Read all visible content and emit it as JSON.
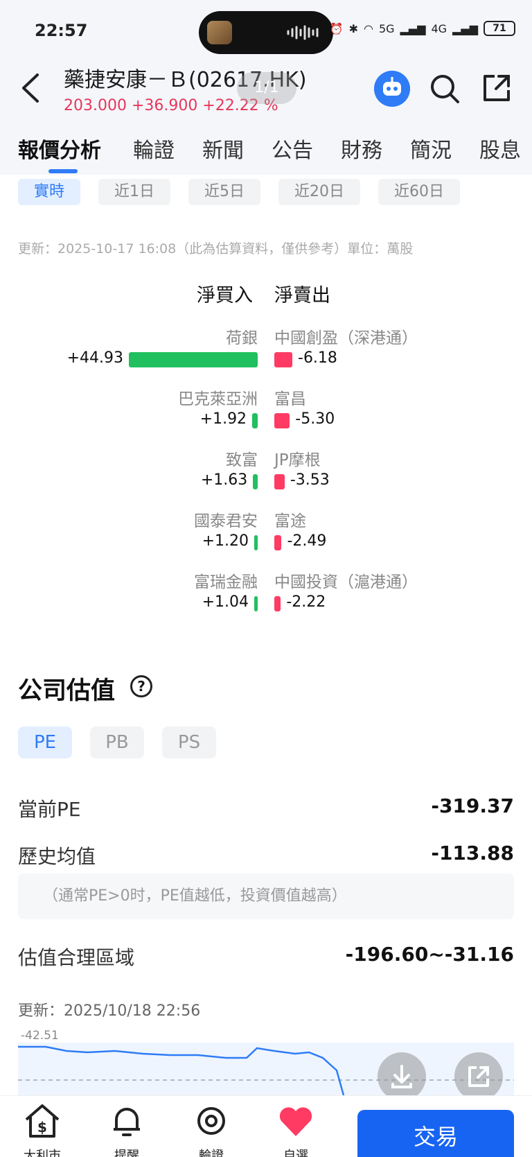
{
  "status_bar": {
    "time": "22:57",
    "net1": "5G",
    "net2": "4G",
    "battery": "71"
  },
  "header": {
    "stock_name": "藥捷安康－Ｂ(02617.HK)",
    "price_line": "203.000 +36.900 +22.22 %",
    "page_indicator": "1/1"
  },
  "tabs": [
    "報價分析",
    "輪證",
    "新聞",
    "公告",
    "財務",
    "簡況",
    "股息"
  ],
  "broker_flow": {
    "periods": [
      "實時",
      "近1日",
      "近5日",
      "近20日",
      "近60日"
    ],
    "update_note": "更新：2025-10-17 16:08（此為估算資料，僅供參考）單位：萬股",
    "buy_header": "淨買入",
    "sell_header": "淨賣出",
    "buyers": [
      {
        "name": "荷銀",
        "value": "+44.93",
        "amount": 44.93
      },
      {
        "name": "巴克萊亞洲",
        "value": "+1.92",
        "amount": 1.92
      },
      {
        "name": "致富",
        "value": "+1.63",
        "amount": 1.63
      },
      {
        "name": "國泰君安",
        "value": "+1.20",
        "amount": 1.2
      },
      {
        "name": "富瑞金融",
        "value": "+1.04",
        "amount": 1.04
      }
    ],
    "sellers": [
      {
        "name": "中國創盈（深港通）",
        "value": "-6.18",
        "amount": 6.18
      },
      {
        "name": "富昌",
        "value": "-5.30",
        "amount": 5.3
      },
      {
        "name": "JP摩根",
        "value": "-3.53",
        "amount": 3.53
      },
      {
        "name": "富途",
        "value": "-2.49",
        "amount": 2.49
      },
      {
        "name": "中國投資（滬港通）",
        "value": "-2.22",
        "amount": 2.22
      }
    ]
  },
  "valuation": {
    "title": "公司估值",
    "help_symbol": "?",
    "tabs": [
      "PE",
      "PB",
      "PS"
    ],
    "current_label": "當前PE",
    "current_value": "-319.37",
    "avg_label": "歷史均值",
    "avg_value": "-113.88",
    "hint": "（通常PE>0时，PE值越低，投資價值越高）",
    "range_label": "估值合理區域",
    "range_value": "-196.60~-31.16",
    "chart_update": "更新：2025/10/18 22:56",
    "chart_top_label": "-42.51"
  },
  "bottom_nav": {
    "items": [
      "大利市",
      "提醒",
      "輪證",
      "自選"
    ],
    "trade": "交易"
  },
  "colors": {
    "accent": "#2f7cf6",
    "up": "#e8365a",
    "buy_bar": "#1fc05d",
    "sell_bar": "#ff3b63",
    "trade": "#1864f2"
  }
}
